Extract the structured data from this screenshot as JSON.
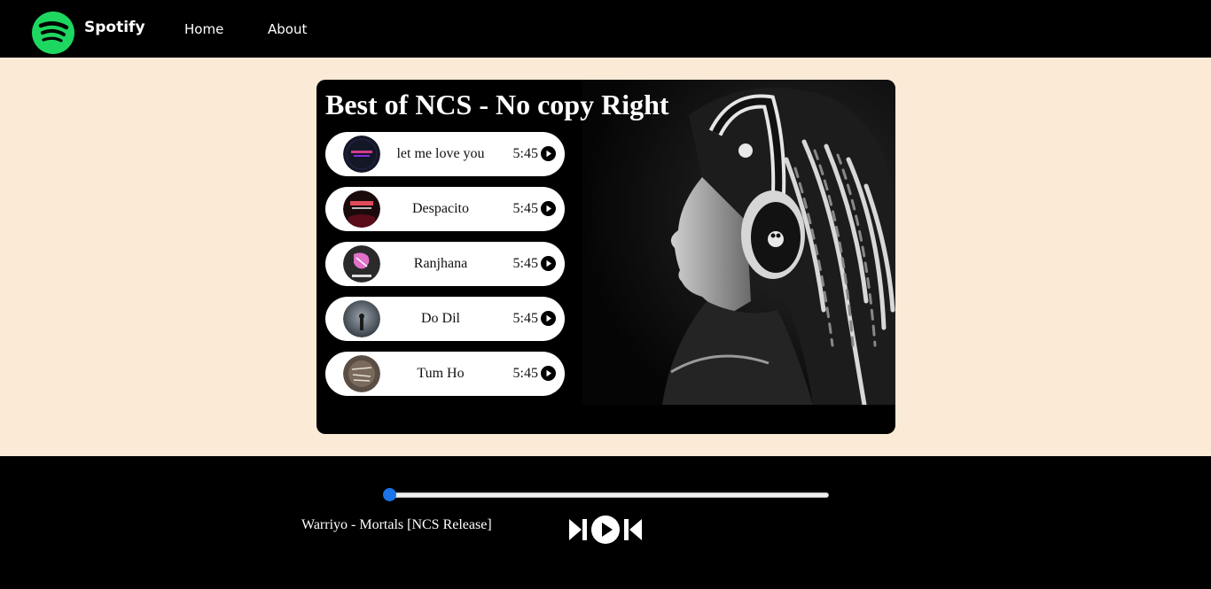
{
  "navbar": {
    "brand": "Spotify",
    "links": [
      "Home",
      "About"
    ],
    "logo_icon": "spotify-logo-icon",
    "logo_color": "#1ed760"
  },
  "playlist": {
    "title": "Best of NCS - No copy Right",
    "songs": [
      {
        "name": "let me love you",
        "duration": "5:45"
      },
      {
        "name": "Despacito",
        "duration": "5:45"
      },
      {
        "name": "Ranjhana",
        "duration": "5:45"
      },
      {
        "name": "Do Dil",
        "duration": "5:45"
      },
      {
        "name": "Tum Ho",
        "duration": "5:45"
      }
    ]
  },
  "player": {
    "now_playing": "Warriyo - Mortals [NCS Release]",
    "progress": 0,
    "accent": "#1a73e8",
    "controls": [
      "previous-icon",
      "play-icon",
      "next-icon"
    ]
  },
  "colors": {
    "page_background": "#fbead6",
    "bar_background": "#000000"
  }
}
